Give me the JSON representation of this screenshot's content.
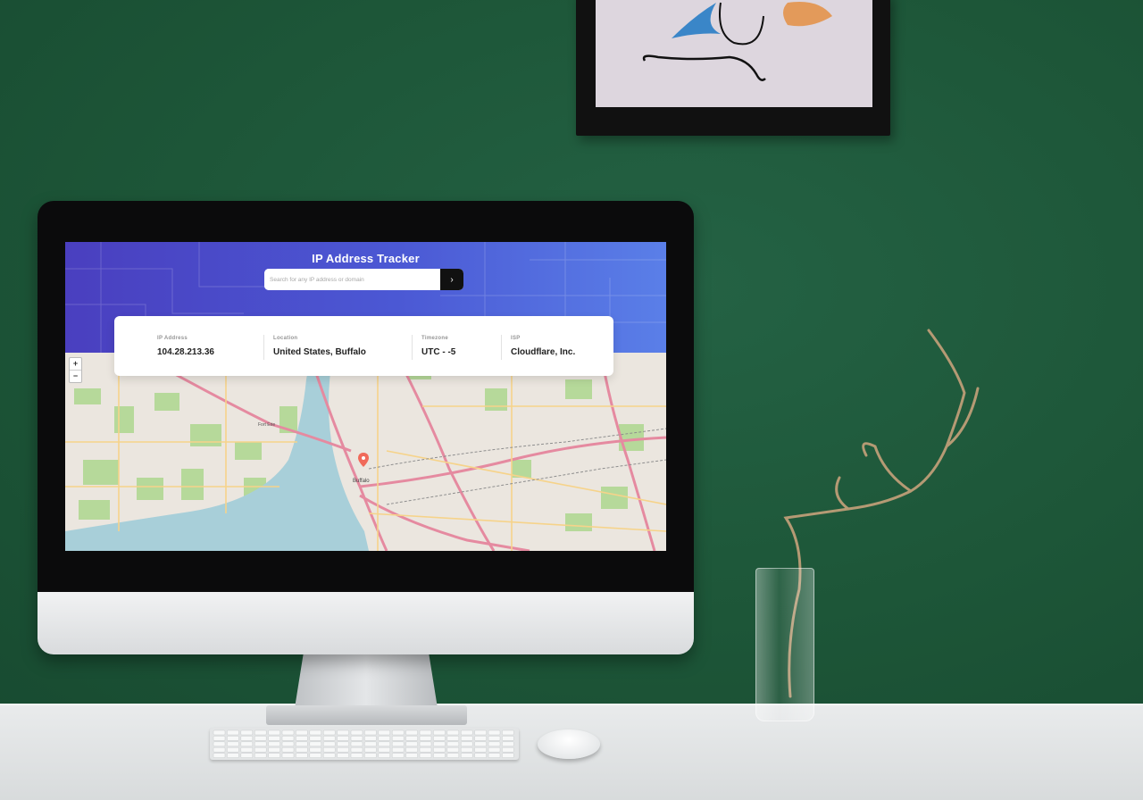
{
  "app": {
    "title": "IP Address Tracker"
  },
  "search": {
    "placeholder": "Search for any IP address or domain",
    "value": "",
    "submit_glyph": "›"
  },
  "info": [
    {
      "label": "IP Address",
      "value": "104.28.213.36"
    },
    {
      "label": "Location",
      "value": "United States, Buffalo"
    },
    {
      "label": "Timezone",
      "value": "UTC - -5"
    },
    {
      "label": "ISP",
      "value": "Cloudflare, Inc."
    }
  ],
  "map": {
    "zoom_in": "+",
    "zoom_out": "−",
    "labels": [
      "Buffalo",
      "Fort Erie"
    ],
    "marker_icon": "location-pin-icon",
    "colors": {
      "land": "#ebe6df",
      "water": "#a8cfd9",
      "park": "#b6d99a",
      "highway": "#e58aa0",
      "road": "#f6d38a",
      "marker": "#f06a5a"
    }
  },
  "theme": {
    "hero_gradient": [
      "#4a3fbf",
      "#5a7fe8"
    ],
    "search_button": "#111111"
  }
}
